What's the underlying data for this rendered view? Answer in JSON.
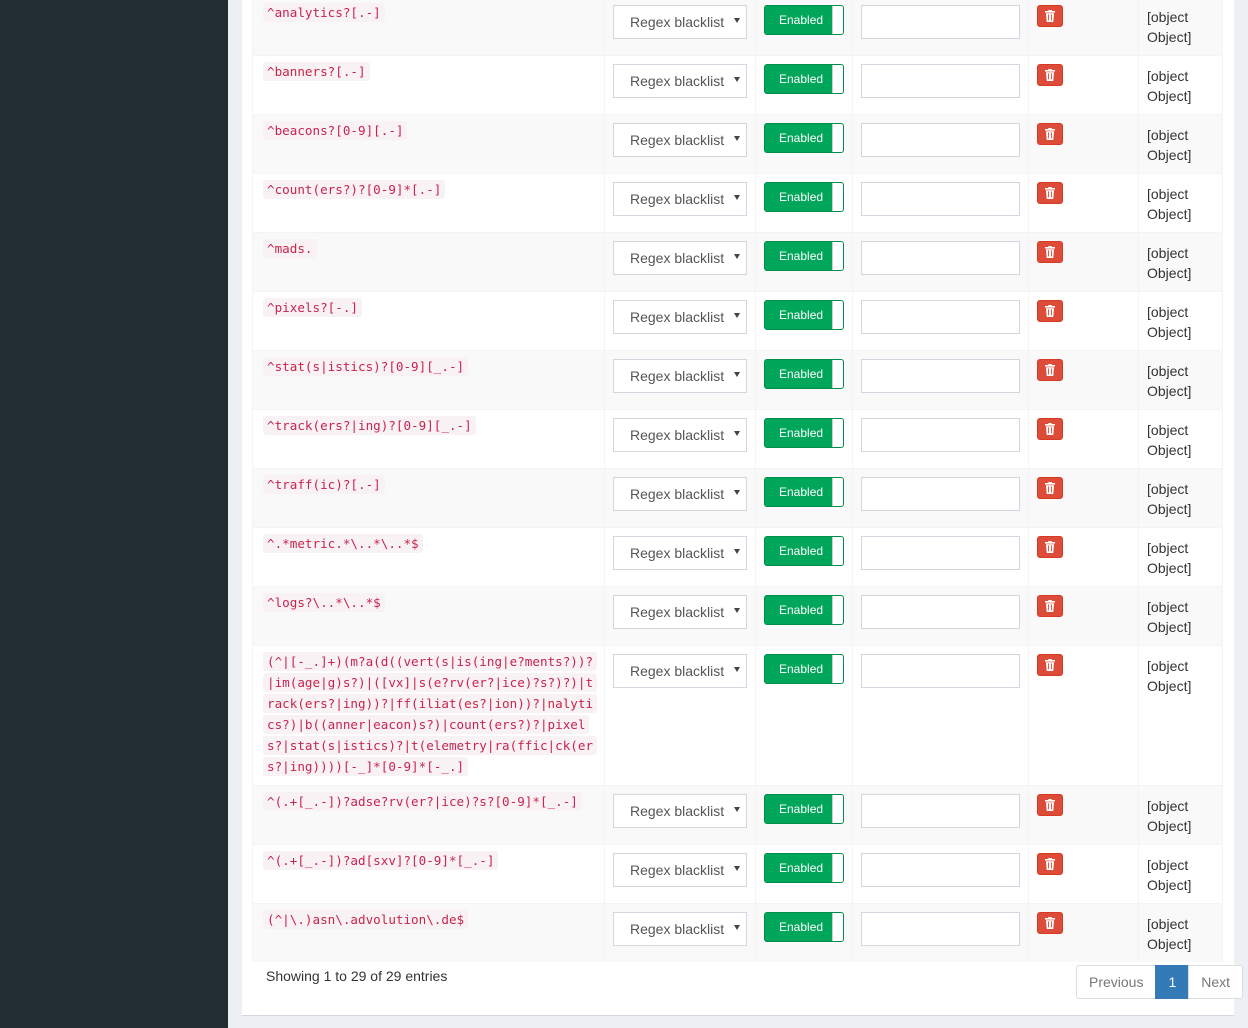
{
  "rows": [
    {
      "domain": "^analytics?[.-]",
      "type": "Regex blacklist",
      "status": "Enabled",
      "groups": "[object Object]"
    },
    {
      "domain": "^banners?[.-]",
      "type": "Regex blacklist",
      "status": "Enabled",
      "groups": "[object Object]"
    },
    {
      "domain": "^beacons?[0-9][.-]",
      "type": "Regex blacklist",
      "status": "Enabled",
      "groups": "[object Object]"
    },
    {
      "domain": "^count(ers?)?[0-9]*[.-]",
      "type": "Regex blacklist",
      "status": "Enabled",
      "groups": "[object Object]"
    },
    {
      "domain": "^mads.",
      "type": "Regex blacklist",
      "status": "Enabled",
      "groups": "[object Object]"
    },
    {
      "domain": "^pixels?[-.]",
      "type": "Regex blacklist",
      "status": "Enabled",
      "groups": "[object Object]"
    },
    {
      "domain": "^stat(s|istics)?[0-9][_.-]",
      "type": "Regex blacklist",
      "status": "Enabled",
      "groups": "[object Object]"
    },
    {
      "domain": "^track(ers?|ing)?[0-9][_.-]",
      "type": "Regex blacklist",
      "status": "Enabled",
      "groups": "[object Object]"
    },
    {
      "domain": "^traff(ic)?[.-]",
      "type": "Regex blacklist",
      "status": "Enabled",
      "groups": "[object Object]"
    },
    {
      "domain": "^.*metric.*\\..*\\..*$",
      "type": "Regex blacklist",
      "status": "Enabled",
      "groups": "[object Object]"
    },
    {
      "domain": "^logs?\\..*\\..*$",
      "type": "Regex blacklist",
      "status": "Enabled",
      "groups": "[object Object]"
    },
    {
      "domain": "(^|[-_.]+)(m?a(d((vert(s|is(ing|e?ments?))?|im(age|g)s?)|([vx]|s(e?rv(er?|ice)?s?)?)|track(ers?|ing))?|ff(iliat(es?|ion))?|nalytics?)|b((anner|eacon)s?)|count(ers?)?|pixels?|stat(s|istics)?|t(elemetry|ra(ffic|ck(ers?|ing))))[-_]*[0-9]*[-_.]",
      "type": "Regex blacklist",
      "status": "Enabled",
      "groups": "[object Object]"
    },
    {
      "domain": "^(.+[_.-])?adse?rv(er?|ice)?s?[0-9]*[_.-]",
      "type": "Regex blacklist",
      "status": "Enabled",
      "groups": "[object Object]"
    },
    {
      "domain": "^(.+[_.-])?ad[sxv]?[0-9]*[_.-]",
      "type": "Regex blacklist",
      "status": "Enabled",
      "groups": "[object Object]"
    },
    {
      "domain": "(^|\\.)asn\\.advolution\\.de$",
      "type": "Regex blacklist",
      "status": "Enabled",
      "groups": "[object Object]"
    }
  ],
  "footer": {
    "info": "Showing 1 to 29 of 29 entries",
    "previous": "Previous",
    "page": "1",
    "next": "Next"
  },
  "colors": {
    "sidebar": "#222d32",
    "enabled": "#00a65a",
    "delete": "#dd4b39",
    "code_text": "#c7254e",
    "page_active": "#337ab7"
  }
}
